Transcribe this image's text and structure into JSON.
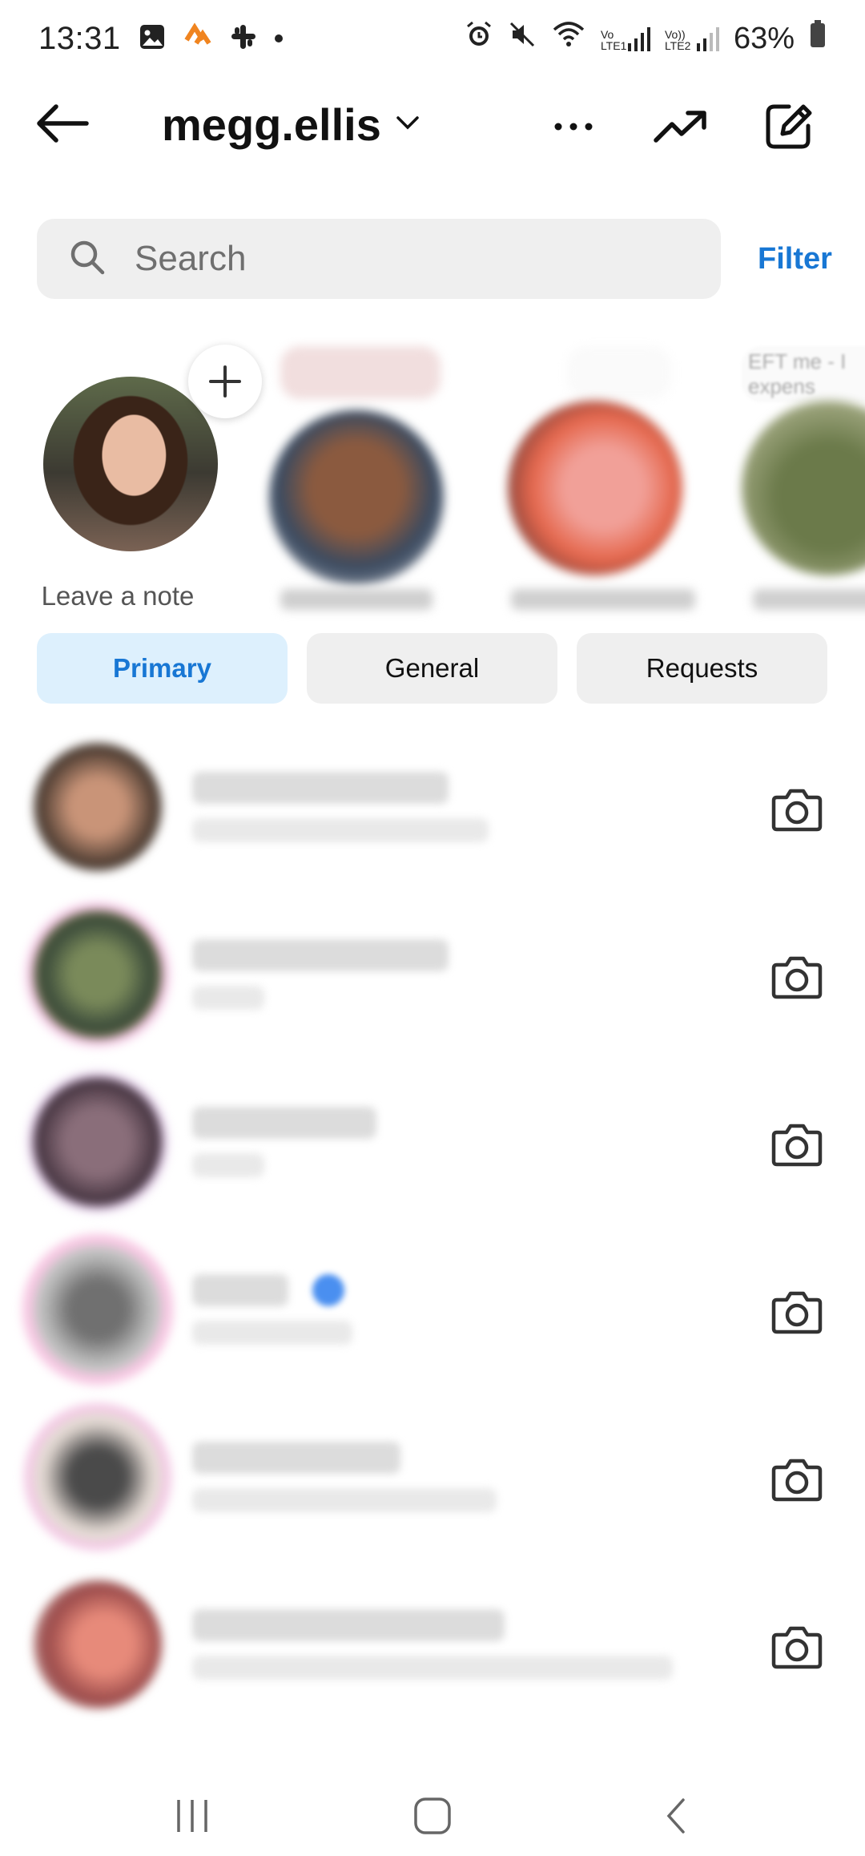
{
  "status_bar": {
    "time": "13:31",
    "battery": "63%",
    "left_icons": [
      "image-icon",
      "strava-icon",
      "slack-icon",
      "notification-dot"
    ],
    "right_icons": [
      "alarm-icon",
      "mute-icon",
      "wifi-icon",
      "volte1-signal-icon",
      "volte2-signal-icon",
      "battery-icon"
    ],
    "volte1_label": "Vo LTE1",
    "volte2_label": "Vo)) LTE2"
  },
  "header": {
    "account_name": "megg.ellis",
    "icons": [
      "back-arrow-icon",
      "chevron-down-icon",
      "more-icon",
      "trending-icon",
      "compose-icon"
    ]
  },
  "search": {
    "placeholder": "Search",
    "filter_label": "Filter"
  },
  "notes": {
    "own_note_label": "Leave a note",
    "add_icon": "plus-icon",
    "partial_note_text": "EFT me - I expens"
  },
  "tabs": [
    {
      "label": "Primary",
      "active": true
    },
    {
      "label": "General",
      "active": false
    },
    {
      "label": "Requests",
      "active": false
    }
  ],
  "threads": {
    "row_icon": "camera-icon",
    "count": 6
  },
  "nav": {
    "icons": [
      "recent-apps-icon",
      "home-icon",
      "back-icon"
    ]
  },
  "colors": {
    "accent": "#1877d4",
    "tab_active_bg": "#ddf0fd",
    "tab_bg": "#efefef",
    "search_bg": "#efefef"
  }
}
